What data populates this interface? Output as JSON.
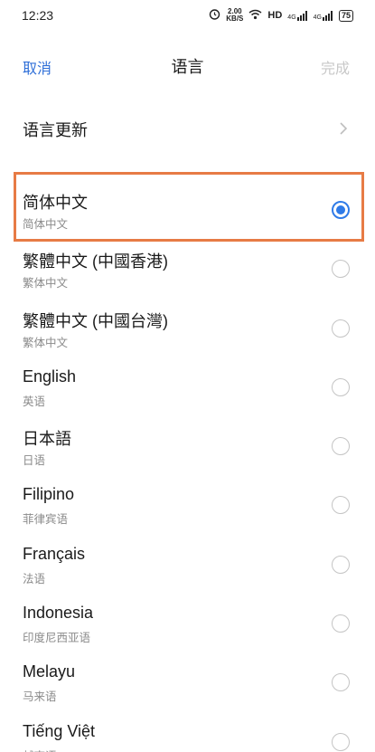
{
  "status_bar": {
    "time": "12:23",
    "speed_value": "2.00",
    "speed_unit": "KB/S",
    "network": "HD",
    "signal1": "4G",
    "signal2": "4G",
    "battery": "75"
  },
  "nav": {
    "cancel_label": "取消",
    "title": "语言",
    "done_label": "完成"
  },
  "update": {
    "label": "语言更新"
  },
  "languages": [
    {
      "name": "简体中文",
      "sub": "简体中文",
      "selected": true
    },
    {
      "name": "繁體中文 (中國香港)",
      "sub": "繁体中文",
      "selected": false
    },
    {
      "name": "繁體中文 (中國台灣)",
      "sub": "繁体中文",
      "selected": false
    },
    {
      "name": "English",
      "sub": "英语",
      "selected": false
    },
    {
      "name": "日本語",
      "sub": "日语",
      "selected": false
    },
    {
      "name": "Filipino",
      "sub": "菲律宾语",
      "selected": false
    },
    {
      "name": "Français",
      "sub": "法语",
      "selected": false
    },
    {
      "name": "Indonesia",
      "sub": "印度尼西亚语",
      "selected": false
    },
    {
      "name": "Melayu",
      "sub": "马来语",
      "selected": false
    },
    {
      "name": "Tiếng Việt",
      "sub": "越南语",
      "selected": false
    }
  ],
  "colors": {
    "accent": "#2f7be8",
    "highlight": "#e77b45"
  }
}
